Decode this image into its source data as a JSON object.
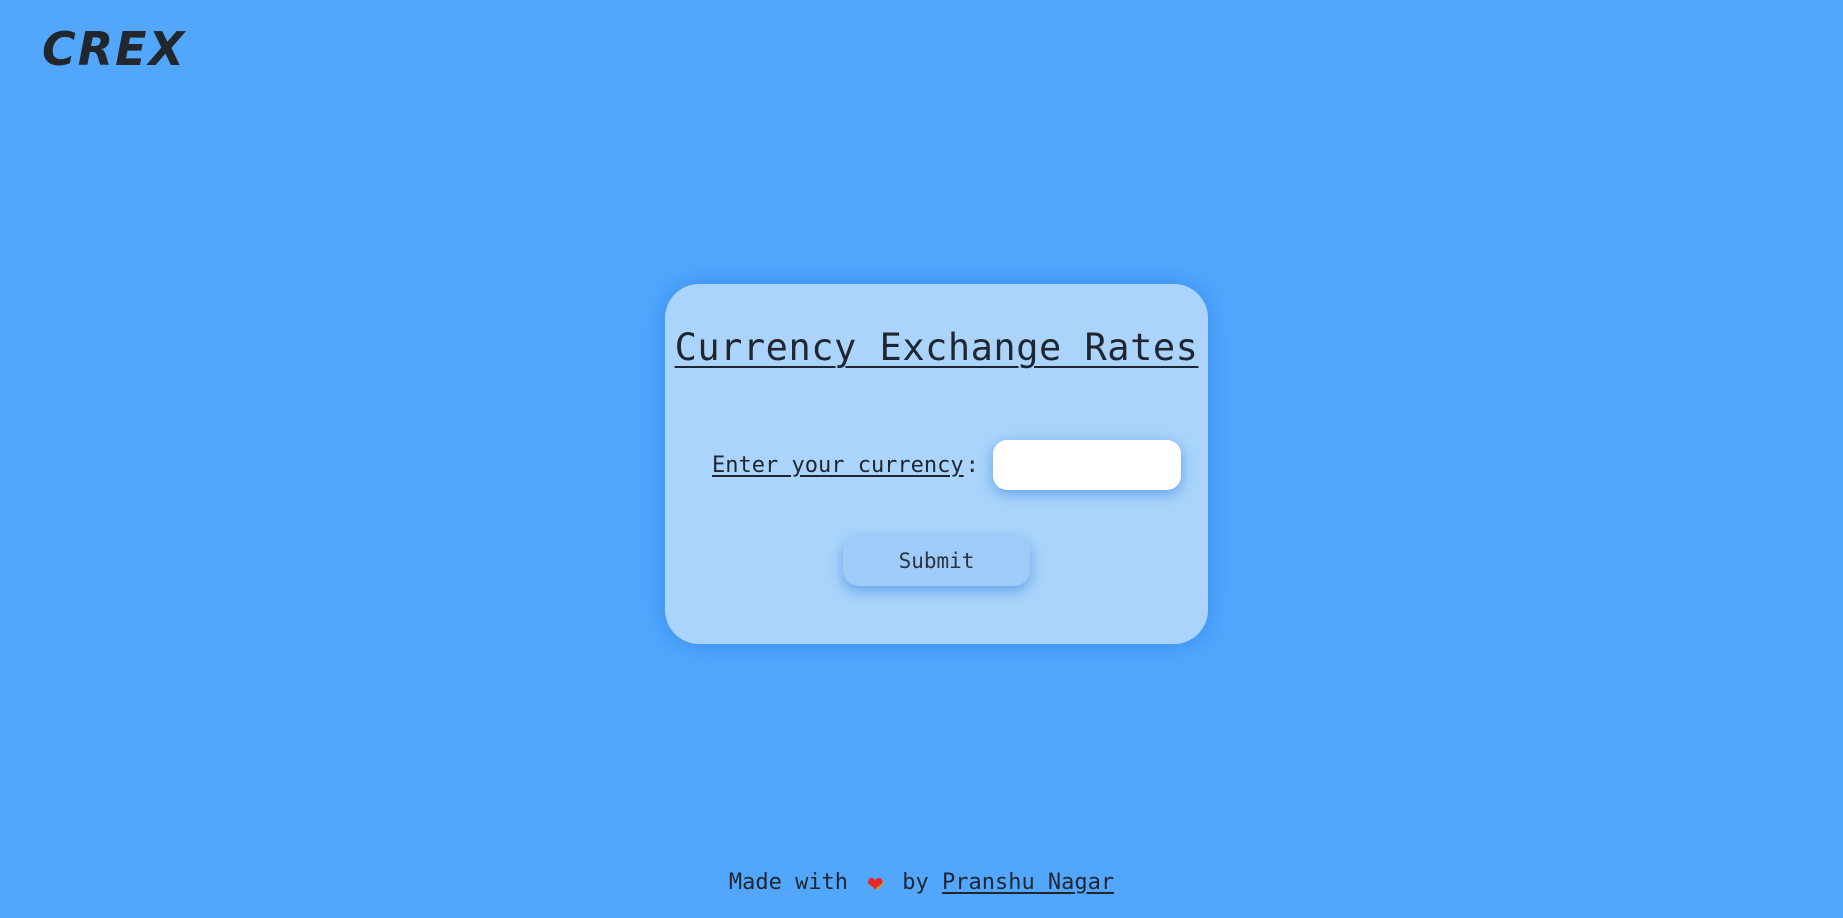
{
  "header": {
    "logo": "CREX"
  },
  "card": {
    "title": "Currency Exchange Rates",
    "input_label": "Enter your currency",
    "colon": ":",
    "input_value": "",
    "input_placeholder": "",
    "submit_label": "Submit"
  },
  "footer": {
    "made_with": "Made with",
    "heart_icon": "❤",
    "by": "by",
    "author": "Pranshu Nagar"
  },
  "colors": {
    "background": "#52a7fd",
    "card": "#aad4fb",
    "text": "#1f2630",
    "heart": "#e4252c"
  }
}
